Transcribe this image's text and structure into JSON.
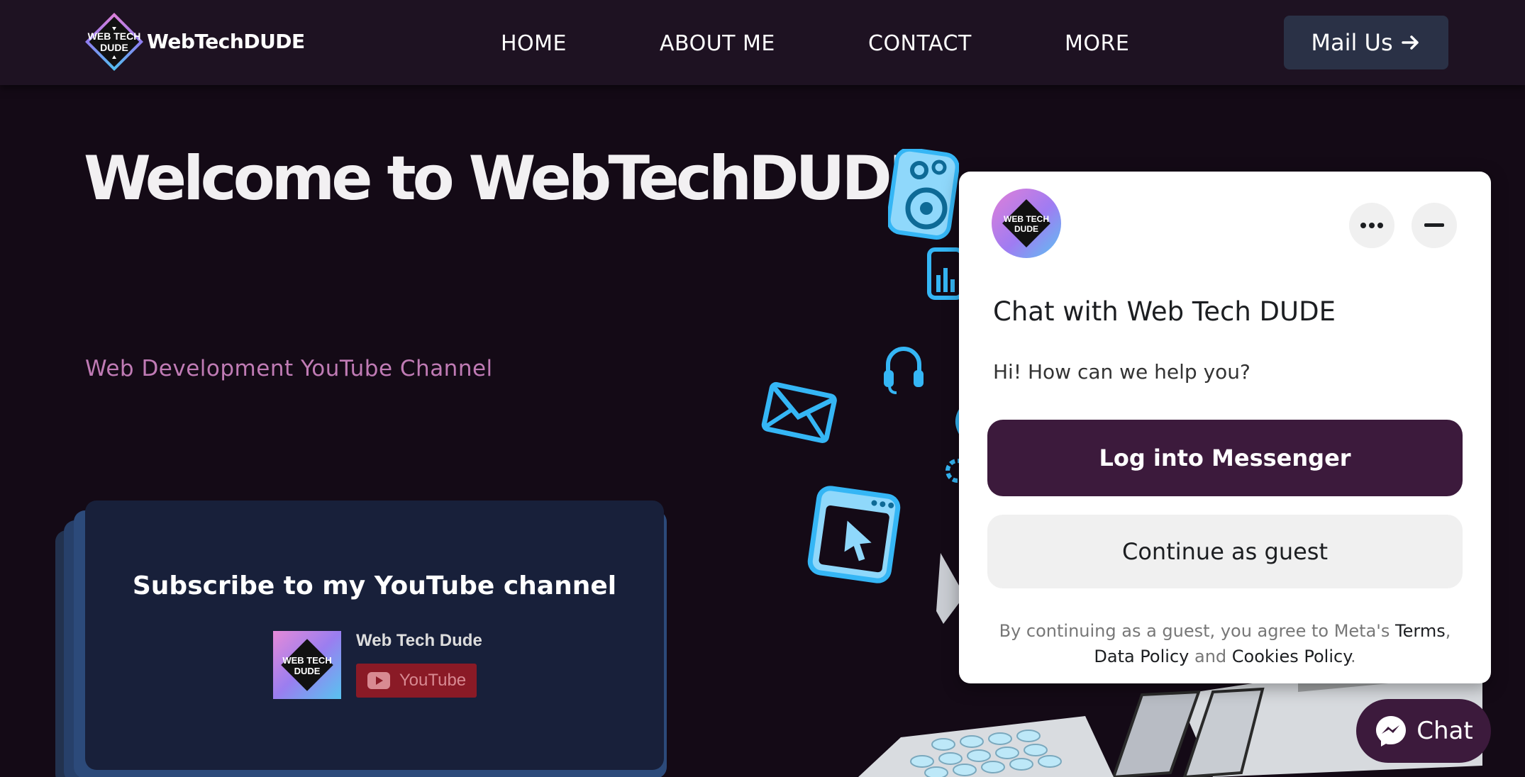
{
  "header": {
    "logo_text": "WEB TECH DUDE",
    "brand": "WebTechDUDE",
    "nav": [
      "HOME",
      "ABOUT ME",
      "CONTACT",
      "MORE"
    ],
    "mail_button": "Mail Us"
  },
  "hero": {
    "title": "Welcome to WebTechDUDE",
    "subtitle": "Web Development YouTube Channel"
  },
  "subscribe_card": {
    "title": "Subscribe to my YouTube channel",
    "channel_name": "Web Tech Dude",
    "button_label": "YouTube"
  },
  "chat_widget": {
    "title": "Chat with Web Tech DUDE",
    "greeting": "Hi! How can we help you?",
    "login_button": "Log into Messenger",
    "guest_button": "Continue as guest",
    "legal_prefix": "By continuing as a guest, you agree to Meta's",
    "terms": "Terms",
    "data_policy": "Data Policy",
    "and": "and",
    "cookies_policy": "Cookies Policy",
    "fab_label": "Chat"
  },
  "colors": {
    "page_bg": "#140a16",
    "header_bg": "#1e1222",
    "accent_purple": "#3c1a3c",
    "subtitle_pink": "#c07bb5",
    "icon_blue": "#35b6f5",
    "card_bg": "#18203a"
  },
  "icons": [
    "speaker-icon",
    "equalizer-icon",
    "headphones-icon",
    "envelope-icon",
    "cursor-window-icon",
    "gear-icon",
    "messenger-icon",
    "arrow-right-icon",
    "more-icon",
    "minimize-icon",
    "youtube-play-icon"
  ]
}
